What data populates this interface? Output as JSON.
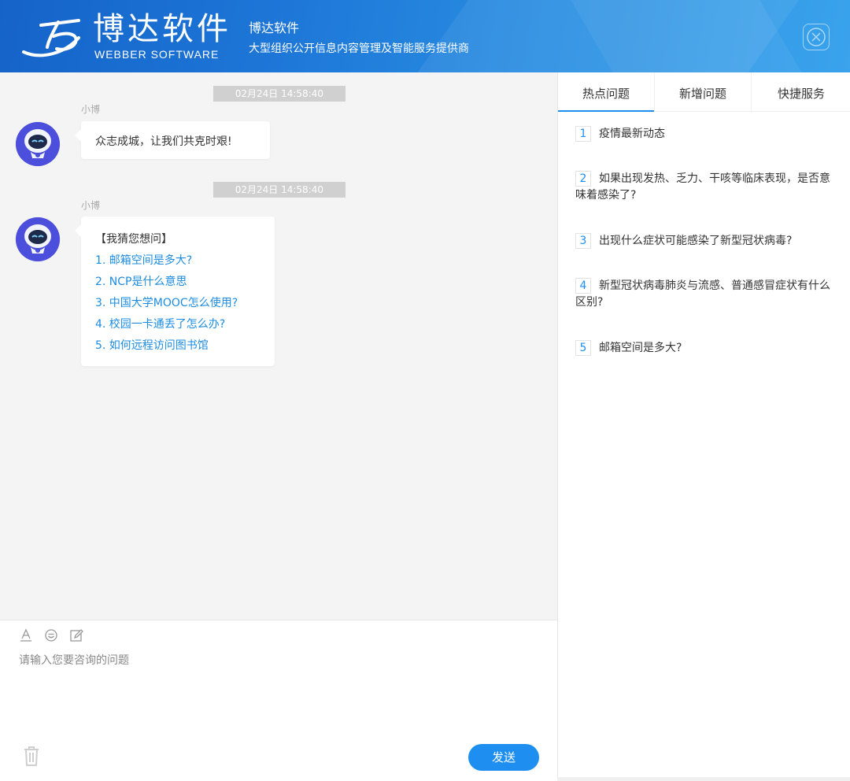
{
  "header": {
    "logo_cn": "博达软件",
    "logo_en": "WEBBER SOFTWARE",
    "brand_name": "博达软件",
    "slogan": "大型组织公开信息内容管理及智能服务提供商",
    "close_icon": "close-icon"
  },
  "chat": {
    "messages": [
      {
        "timestamp": "02月24日 14:58:40",
        "sender": "小博",
        "text": "众志成城，让我们共克时艰!"
      },
      {
        "timestamp": "02月24日 14:58:40",
        "sender": "小博",
        "title": "【我猜您想问】",
        "questions": [
          "1. 邮箱空间是多大?",
          "2. NCP是什么意思",
          "3. 中国大学MOOC怎么使用?",
          "4. 校园一卡通丢了怎么办?",
          "5. 如何远程访问图书馆"
        ]
      }
    ]
  },
  "input": {
    "placeholder": "请输入您要咨询的问题",
    "value": "",
    "tools": [
      "font-icon",
      "emoji-icon",
      "edit-icon"
    ],
    "send_label": "发送",
    "trash_icon": "trash-icon"
  },
  "right": {
    "tabs": [
      "热点问题",
      "新增问题",
      "快捷服务"
    ],
    "active_tab": "热点问题",
    "hot_questions": [
      {
        "num": "1",
        "text": "疫情最新动态"
      },
      {
        "num": "2",
        "text": "如果出现发热、乏力、干咳等临床表现，是否意味着感染了?"
      },
      {
        "num": "3",
        "text": "出现什么症状可能感染了新型冠状病毒?"
      },
      {
        "num": "4",
        "text": "新型冠状病毒肺炎与流感、普通感冒症状有什么区别?"
      },
      {
        "num": "5",
        "text": "邮箱空间是多大?"
      }
    ]
  },
  "colors": {
    "accent": "#1e8ff0",
    "header": "#1e78d8",
    "link": "#1d8ce0"
  }
}
